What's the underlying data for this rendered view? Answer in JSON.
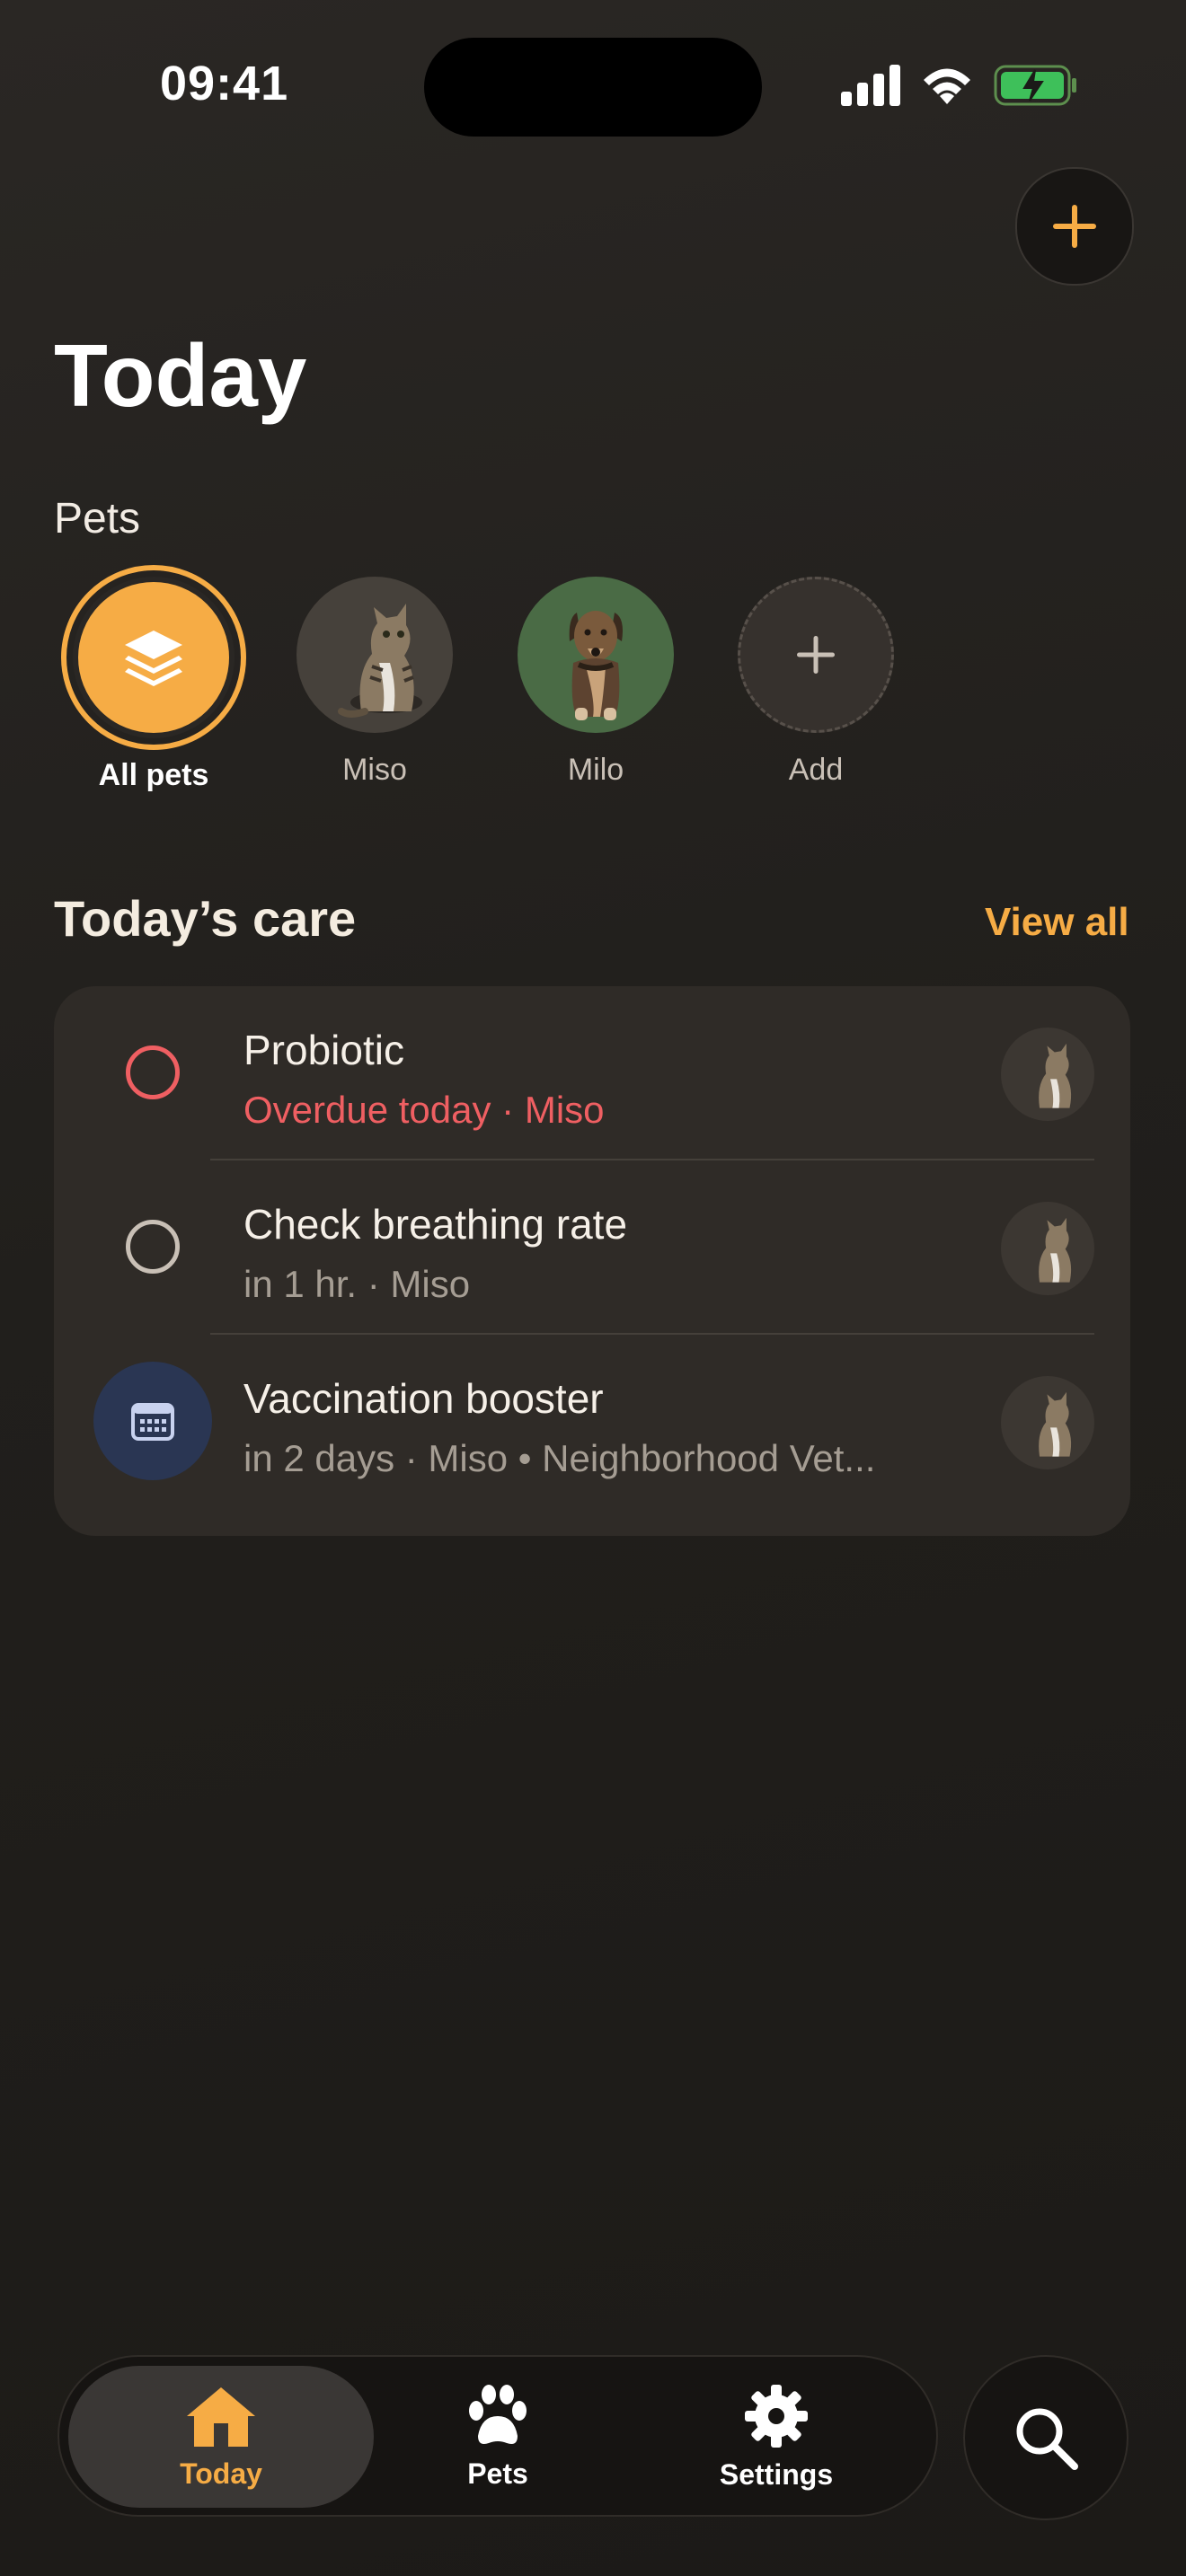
{
  "status_bar": {
    "time": "09:41"
  },
  "header": {
    "title": "Today"
  },
  "pets_section": {
    "label": "Pets",
    "items": [
      {
        "name": "All pets",
        "selected": true
      },
      {
        "name": "Miso"
      },
      {
        "name": "Milo"
      },
      {
        "name": "Add"
      }
    ]
  },
  "care": {
    "title": "Today’s care",
    "view_all": "View all",
    "items": [
      {
        "title": "Probiotic",
        "subtitle": "Overdue today · Miso",
        "status": "overdue"
      },
      {
        "title": "Check breathing rate",
        "subtitle": "in 1 hr. · Miso",
        "status": "pending"
      },
      {
        "title": "Vaccination booster",
        "subtitle": "in 2 days · Miso • Neighborhood Vet...",
        "status": "appointment"
      }
    ]
  },
  "tabbar": {
    "tabs": [
      {
        "label": "Today",
        "active": true
      },
      {
        "label": "Pets"
      },
      {
        "label": "Settings"
      }
    ]
  },
  "colors": {
    "accent": "#f6ac45",
    "overdue": "#ef5f62",
    "background": "#24211e",
    "card": "#2f2b27"
  }
}
